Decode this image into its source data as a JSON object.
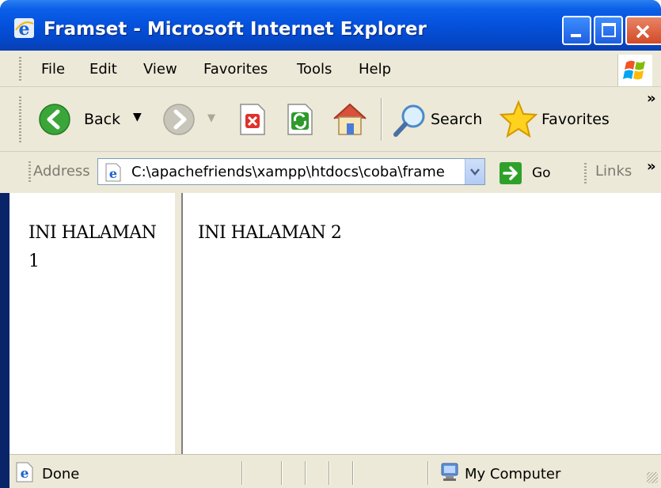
{
  "window": {
    "title": "Framset - Microsoft Internet Explorer"
  },
  "menu": {
    "items": [
      "File",
      "Edit",
      "View",
      "Favorites",
      "Tools",
      "Help"
    ]
  },
  "toolbar": {
    "back_label": "Back",
    "search_label": "Search",
    "favorites_label": "Favorites",
    "overflow": "»"
  },
  "address": {
    "label": "Address",
    "value": "C:\\apachefriends\\xampp\\htdocs\\coba\\frame",
    "go_label": "Go",
    "links_label": "Links",
    "overflow": "»"
  },
  "frames": {
    "left_text": "INI HALAMAN 1",
    "right_text": "INI HALAMAN 2"
  },
  "status": {
    "text": "Done",
    "zone": "My Computer"
  },
  "colors": {
    "title_blue": "#0553de",
    "chrome": "#ece9d8",
    "go_green": "#2fa12a"
  }
}
